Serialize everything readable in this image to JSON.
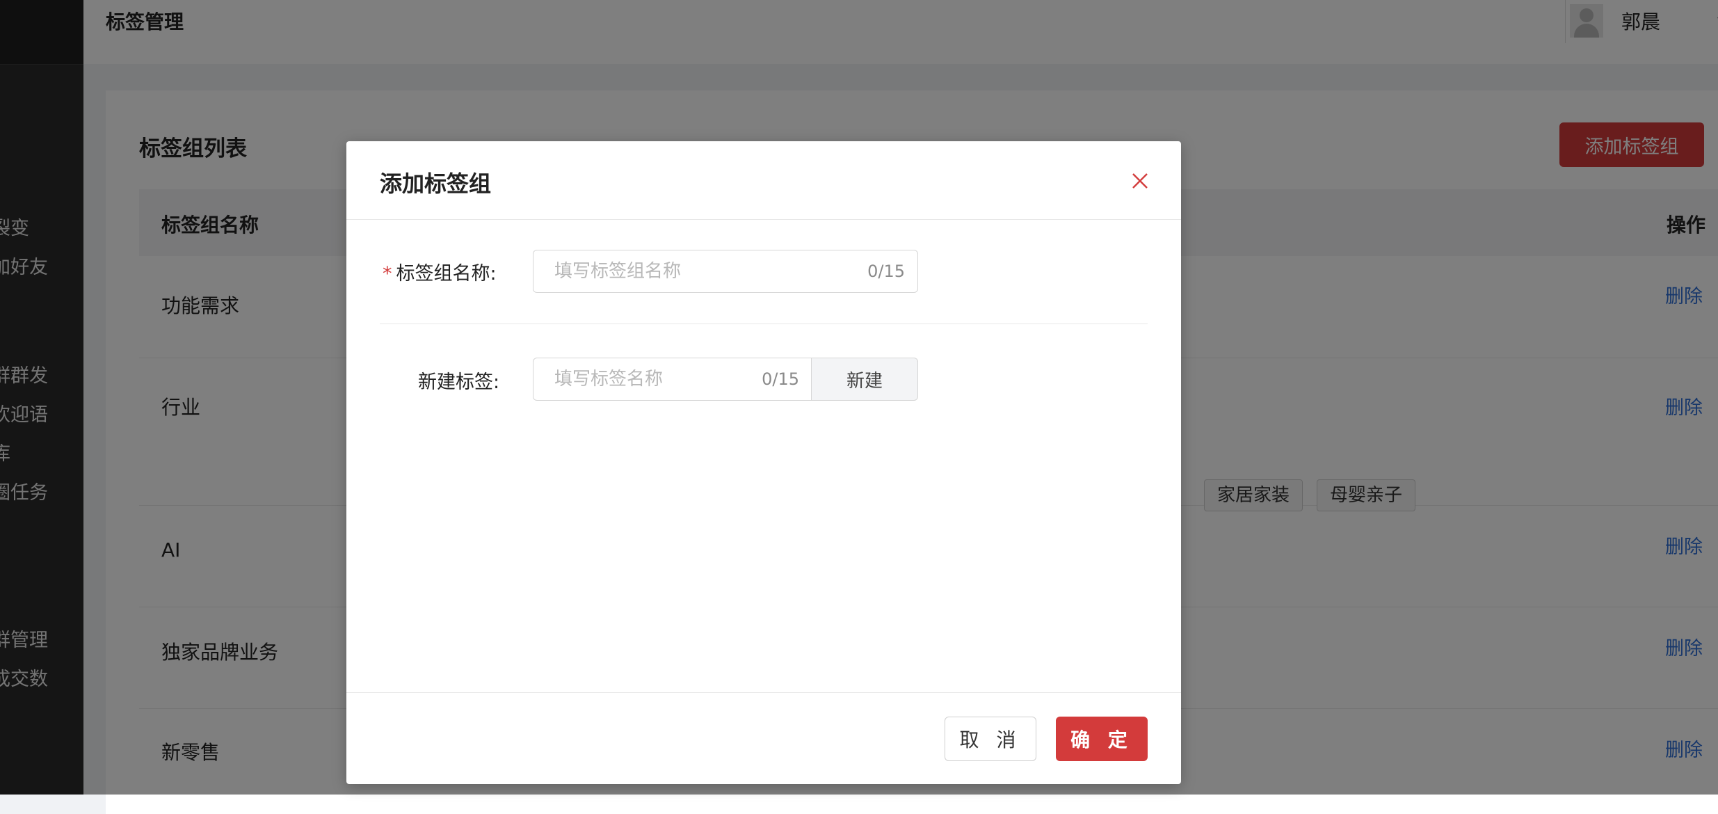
{
  "topbar": {
    "title": "标签管理",
    "user_name": "郭晨"
  },
  "sidebar": {
    "items": [
      {
        "label": "裂变"
      },
      {
        "label": "加好友"
      },
      {
        "label": "群群发"
      },
      {
        "label": "欢迎语"
      },
      {
        "label": "库"
      },
      {
        "label": "圈任务"
      },
      {
        "label": "群管理"
      },
      {
        "label": "成交数"
      }
    ]
  },
  "list": {
    "title": "标签组列表",
    "add_button": "添加标签组",
    "columns": {
      "name": "标签组名称",
      "action": "操作"
    },
    "rows": [
      {
        "name": "功能需求",
        "action": "删除"
      },
      {
        "name": "行业",
        "action": "删除",
        "tags": [
          "家居家装",
          "母婴亲子"
        ]
      },
      {
        "name": "AI",
        "action": "删除"
      },
      {
        "name": "独家品牌业务",
        "action": "删除"
      },
      {
        "name": "新零售",
        "action": "删除"
      }
    ]
  },
  "modal": {
    "title": "添加标签组",
    "group_name": {
      "label": "标签组名称:",
      "placeholder": "填写标签组名称",
      "value": "",
      "counter": "0/15",
      "required": true
    },
    "new_tag": {
      "label": "新建标签:",
      "placeholder": "填写标签名称",
      "value": "",
      "counter": "0/15",
      "button": "新建"
    },
    "cancel": "取 消",
    "confirm": "确 定"
  },
  "colors": {
    "primary": "#d33b3b",
    "link": "#2f6fd6",
    "overlay": "rgba(0,0,0,0.5)"
  }
}
